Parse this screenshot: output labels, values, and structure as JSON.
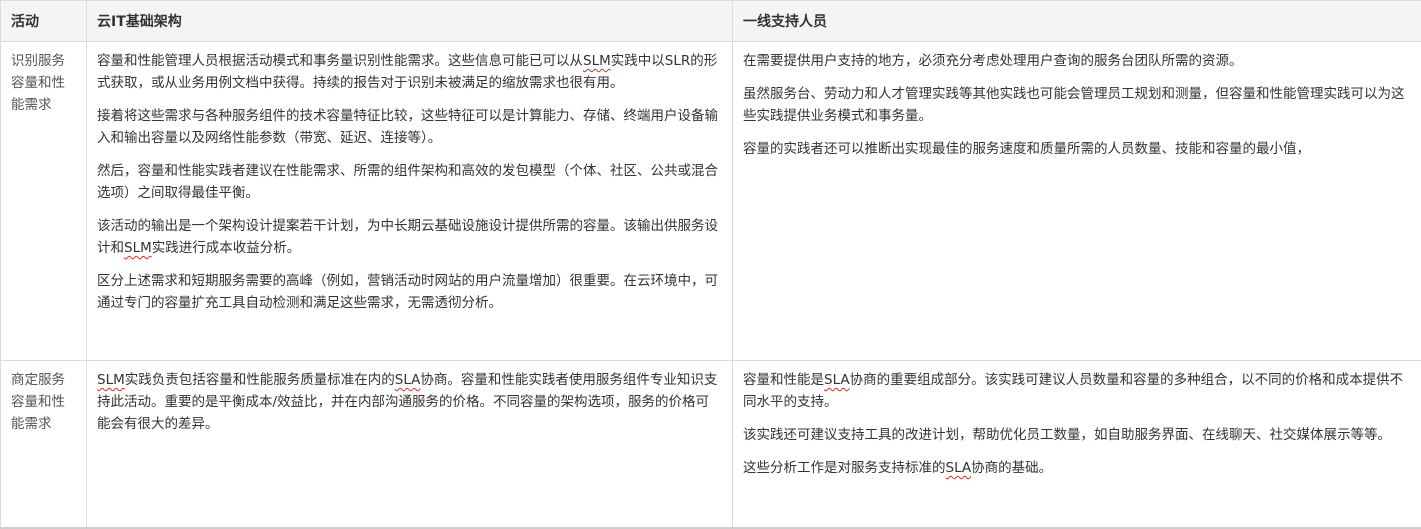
{
  "table": {
    "headers": [
      "活动",
      "云IT基础架构",
      "一线支持人员"
    ],
    "rows": [
      {
        "activity": "识别服务容量和性能需求",
        "cloud_it": [
          [
            "容量和性能管理人员根据活动模式和事务量识别性能需求。这些信息可能已可以从",
            "SLM",
            "实践中以SLR的形式获取，或从业务用例文档中获得。持续的报告对于识别未被满足的缩放需求也很有用。"
          ],
          [
            "接着将这些需求与各种服务组件的技术容量特征比较，这些特征可以是计算能力、存储、终端用户设备输入和输出容量以及网络性能参数（带宽、延迟、连接等）。"
          ],
          [
            "然后，容量和性能实践者建议在性能需求、所需的组件架构和高效的发包模型（个体、社区、公共或混合选项）之间取得最佳平衡。"
          ],
          [
            "该活动的输出是一个架构设计提案若干计划，为中长期云基础设施设计提供所需的容量。该输出供服务设计和",
            "SLM",
            "实践进行成本收益分析。"
          ],
          [
            "区分上述需求和短期服务需要的高峰（例如，营销活动时网站的用户流量增加）很重要。在云环境中，可通过专门的容量扩充工具自动检测和满足这些需求，无需透彻分析。"
          ]
        ],
        "frontline": [
          [
            "在需要提供用户支持的地方，必须充分考虑处理用户查询的服务台团队所需的资源。"
          ],
          [
            "虽然服务台、劳动力和人才管理实践等其他实践也可能会管理员工规划和测量，但容量和性能管理实践可以为这些实践提供业务模式和事务量。"
          ],
          [
            "容量的实践者还可以推断出实现最佳的服务速度和质量所需的人员数量、技能和容量的最小值，"
          ]
        ]
      },
      {
        "activity": "商定服务容量和性能需求",
        "cloud_it": [
          [
            "",
            "SLM",
            "实践负责包括容量和性能服务质量标准在内的",
            "SLA",
            "协商。容量和性能实践者使用服务组件专业知识支持此活动。重要的是平衡成本/效益比，并在内部沟通服务的价格。不同容量的架构选项，服务的价格可能会有很大的差异。"
          ]
        ],
        "frontline": [
          [
            "容量和性能是",
            "SLA",
            "协商的重要组成部分。该实践可建议人员数量和容量的多种组合，以不同的价格和成本提供不同水平的支持。"
          ],
          [
            "该实践还可建议支持工具的改进计划，帮助优化员工数量，如自助服务界面、在线聊天、社交媒体展示等等。"
          ],
          [
            "这些分析工作是对服务支持标准的",
            "SLA",
            "协商的基础。"
          ]
        ]
      }
    ]
  }
}
